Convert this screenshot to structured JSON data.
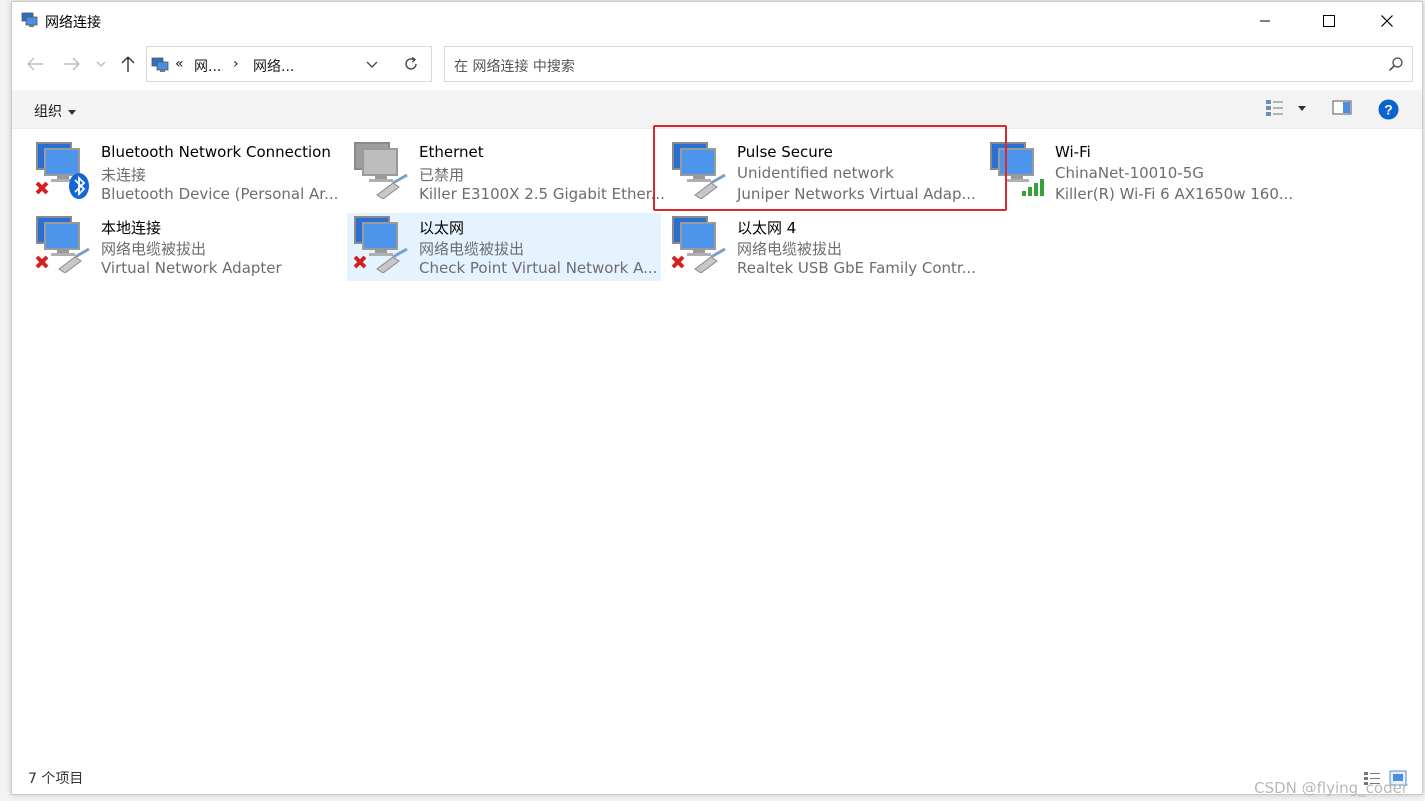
{
  "window": {
    "title": "网络连接",
    "minimize_icon": "minimize-icon",
    "maximize_icon": "maximize-icon",
    "close_icon": "close-icon"
  },
  "nav": {
    "back_icon": "arrow-left-icon",
    "forward_icon": "arrow-right-icon",
    "recent_icon": "chevron-down-icon",
    "up_icon": "arrow-up-icon",
    "breadcrumb": {
      "overflow": "«",
      "segments": [
        "网...",
        "网络..."
      ],
      "separator": "›"
    },
    "refresh_icon": "refresh-icon",
    "search_placeholder": "在 网络连接 中搜索"
  },
  "commandbar": {
    "organize_label": "组织",
    "view_icon": "details-view-icon",
    "preview_pane_icon": "preview-pane-icon",
    "help_icon": "help-icon"
  },
  "connections": [
    {
      "name": "Bluetooth Network Connection",
      "status": "未连接",
      "device": "Bluetooth Device (Personal Ar...",
      "badge": "bluetooth"
    },
    {
      "name": "Ethernet",
      "status": "已禁用",
      "device": "Killer E3100X 2.5 Gigabit Ether...",
      "badge": "disabled"
    },
    {
      "name": "Pulse Secure",
      "status": "Unidentified network",
      "device": "Juniper Networks Virtual Adap...",
      "badge": "cable"
    },
    {
      "name": "Wi-Fi",
      "status": "ChinaNet-10010-5G",
      "device": "Killer(R) Wi-Fi 6 AX1650w 160...",
      "badge": "wifi"
    },
    {
      "name": "本地连接",
      "status": "网络电缆被拔出",
      "device": "Virtual Network Adapter",
      "badge": "unplugged"
    },
    {
      "name": "以太网",
      "status": "网络电缆被拔出",
      "device": "Check Point Virtual Network A...",
      "badge": "unplugged",
      "selected": true
    },
    {
      "name": "以太网 4",
      "status": "网络电缆被拔出",
      "device": "Realtek USB GbE Family Contr...",
      "badge": "unplugged"
    }
  ],
  "statusbar": {
    "item_count": "7 个项目",
    "details_view_icon": "details-view-icon",
    "large_icons_view_icon": "large-icons-view-icon"
  },
  "watermark": "CSDN @flying_coder",
  "colors": {
    "highlight_box": "#e0262c",
    "selection": "#e5f3ff",
    "help": "#0a64d0"
  }
}
